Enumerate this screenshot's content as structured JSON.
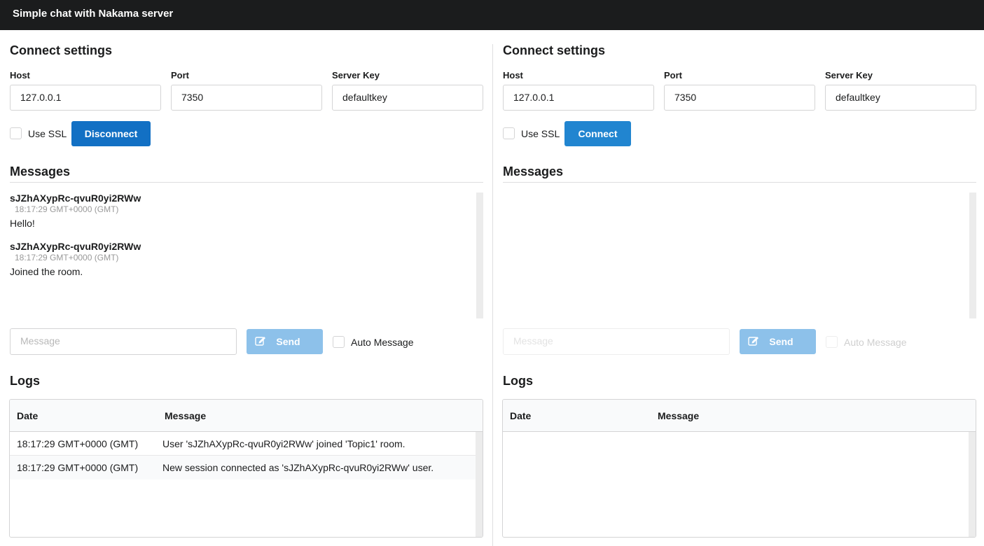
{
  "app": {
    "title": "Simple chat with Nakama server"
  },
  "panels": [
    {
      "connect": {
        "heading": "Connect settings",
        "host_label": "Host",
        "host_value": "127.0.0.1",
        "port_label": "Port",
        "port_value": "7350",
        "key_label": "Server Key",
        "key_value": "defaultkey",
        "ssl_label": "Use SSL",
        "ssl_checked": false,
        "button_label": "Disconnect",
        "button_color": "#1270c4"
      },
      "messages": {
        "heading": "Messages",
        "items": [
          {
            "author": "sJZhAXypRc-qvuR0yi2RWw",
            "time": "18:17:29 GMT+0000 (GMT)",
            "text": "Hello!"
          },
          {
            "author": "sJZhAXypRc-qvuR0yi2RWw",
            "time": "18:17:29 GMT+0000 (GMT)",
            "text": "Joined the room."
          }
        ],
        "input_placeholder": "Message",
        "send_label": "Send",
        "auto_label": "Auto Message",
        "enabled": true
      },
      "logs": {
        "heading": "Logs",
        "col_date": "Date",
        "col_message": "Message",
        "rows": [
          {
            "date": "18:17:29 GMT+0000 (GMT)",
            "message": "User 'sJZhAXypRc-qvuR0yi2RWw' joined 'Topic1' room."
          },
          {
            "date": "18:17:29 GMT+0000 (GMT)",
            "message": "New session connected as 'sJZhAXypRc-qvuR0yi2RWw' user."
          }
        ]
      }
    },
    {
      "connect": {
        "heading": "Connect settings",
        "host_label": "Host",
        "host_value": "127.0.0.1",
        "port_label": "Port",
        "port_value": "7350",
        "key_label": "Server Key",
        "key_value": "defaultkey",
        "ssl_label": "Use SSL",
        "ssl_checked": false,
        "button_label": "Connect",
        "button_color": "#2185d0"
      },
      "messages": {
        "heading": "Messages",
        "items": [],
        "input_placeholder": "Message",
        "send_label": "Send",
        "auto_label": "Auto Message",
        "enabled": false
      },
      "logs": {
        "heading": "Logs",
        "col_date": "Date",
        "col_message": "Message",
        "rows": []
      }
    }
  ]
}
